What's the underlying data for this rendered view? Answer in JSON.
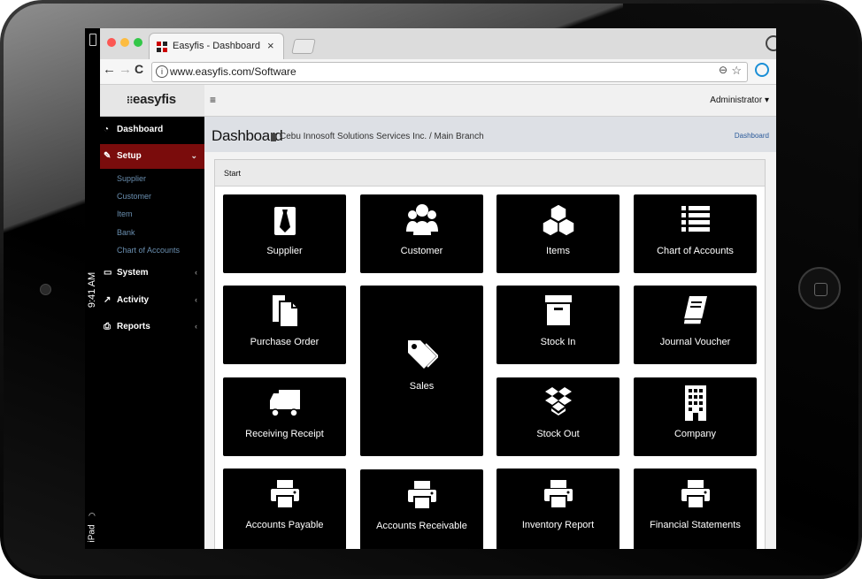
{
  "device": {
    "time": "9:41 AM",
    "model": "iPad"
  },
  "browser": {
    "tab_title": "Easyfis - Dashboard",
    "tab_close": "×",
    "url": "www.easyfis.com/Software",
    "back": "←",
    "forward": "→",
    "reload": "C"
  },
  "app": {
    "brand": "easyfis",
    "user_menu": "Administrator ▾",
    "hamburger": "≡"
  },
  "sidebar": {
    "items": [
      {
        "label": "Dashboard",
        "icon": "dashboard-icon"
      },
      {
        "label": "Setup",
        "icon": "edit-icon",
        "chevron": "⌄"
      },
      {
        "label": "System",
        "icon": "desktop-icon",
        "chevron": "‹"
      },
      {
        "label": "Activity",
        "icon": "chart-icon",
        "chevron": "‹"
      },
      {
        "label": "Reports",
        "icon": "print-icon",
        "chevron": "‹"
      }
    ],
    "setup_sub": [
      "Supplier",
      "Customer",
      "Item",
      "Bank",
      "Chart of Accounts"
    ]
  },
  "page": {
    "title": "Dashboard",
    "breadcrumb": "Cebu Innosoft Solutions Services Inc. / Main Branch",
    "breadcrumb_right": "Dashboard",
    "panel_title": "Start"
  },
  "tiles": [
    {
      "label": "Supplier",
      "icon": "necktie-icon"
    },
    {
      "label": "Customer",
      "icon": "users-icon"
    },
    {
      "label": "Items",
      "icon": "cubes-icon"
    },
    {
      "label": "Chart of Accounts",
      "icon": "list-icon"
    },
    {
      "label": "Purchase Order",
      "icon": "files-icon"
    },
    {
      "label": "Sales",
      "icon": "tags-icon"
    },
    {
      "label": "Stock In",
      "icon": "archive-icon"
    },
    {
      "label": "Journal Voucher",
      "icon": "book-icon"
    },
    {
      "label": "Receiving Receipt",
      "icon": "truck-icon"
    },
    {
      "label": "Stock Out",
      "icon": "dropbox-icon"
    },
    {
      "label": "Company",
      "icon": "building-icon"
    },
    {
      "label": "Accounts Payable",
      "icon": "print-icon"
    },
    {
      "label": "Accounts Receivable",
      "icon": "print-icon"
    },
    {
      "label": "Inventory Report",
      "icon": "print-icon"
    },
    {
      "label": "Financial Statements",
      "icon": "print-icon"
    }
  ],
  "colors": {
    "sidebar_bg": "#000000",
    "setup_active": "#7a0c0c",
    "tile_bg": "#000000",
    "submenu_text": "#6a8fb0"
  }
}
